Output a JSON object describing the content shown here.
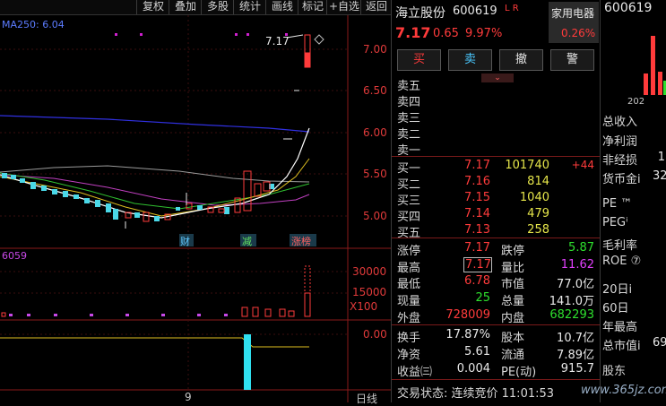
{
  "toolbar": {
    "items": [
      "复权",
      "叠加",
      "多股",
      "统计",
      "画线",
      "标记",
      "+自选",
      "返回"
    ]
  },
  "chart": {
    "ma_label": "MA250: 6.04",
    "price_ticks": [
      "7.00",
      "6.50",
      "6.00",
      "5.50",
      "5.00"
    ],
    "high_label": "7.17",
    "markers": [
      "财",
      "减",
      "涨榜"
    ],
    "vol_label": "6059",
    "vol_ticks": [
      "30000",
      "15000"
    ],
    "vol_unit": "X100",
    "macd_tick": "0.00",
    "date_label": "9",
    "period_label": "日线"
  },
  "quote": {
    "name": "海立股份",
    "code": "600619",
    "flags": "L R",
    "price": "7.17",
    "change": "0.65",
    "change_pct": "9.97%",
    "sector": "家用电器",
    "sector_pct": "0.26%",
    "buttons": {
      "buy": "买",
      "sell": "卖",
      "cancel": "撤",
      "alert": "警"
    },
    "asks": [
      {
        "label": "卖五",
        "price": "",
        "vol": ""
      },
      {
        "label": "卖四",
        "price": "",
        "vol": ""
      },
      {
        "label": "卖三",
        "price": "",
        "vol": ""
      },
      {
        "label": "卖二",
        "price": "",
        "vol": ""
      },
      {
        "label": "卖一",
        "price": "",
        "vol": ""
      }
    ],
    "bids": [
      {
        "label": "买一",
        "price": "7.17",
        "vol": "101740",
        "delta": "+44"
      },
      {
        "label": "买二",
        "price": "7.16",
        "vol": "814"
      },
      {
        "label": "买三",
        "price": "7.15",
        "vol": "1040"
      },
      {
        "label": "买四",
        "price": "7.14",
        "vol": "479"
      },
      {
        "label": "买五",
        "price": "7.13",
        "vol": "258"
      }
    ],
    "stats": {
      "limit_up_l": "涨停",
      "limit_up": "7.17",
      "limit_down_l": "跌停",
      "limit_down": "5.87",
      "high_l": "最高",
      "high": "7.17",
      "ratio_l": "量比",
      "ratio": "11.62",
      "low_l": "最低",
      "low": "6.78",
      "mcap_l": "市值",
      "mcap": "77.0亿",
      "now_l": "现量",
      "now": "25",
      "total_l": "总量",
      "total": "141.0万",
      "outer_l": "外盘",
      "outer": "728009",
      "inner_l": "内盘",
      "inner": "682293",
      "turn_l": "换手",
      "turn": "17.87%",
      "cap_l": "股本",
      "cap": "10.7亿",
      "nav_l": "净资",
      "nav": "5.61",
      "float_l": "流通",
      "float": "7.89亿",
      "eps_l": "收益㈢",
      "eps": "0.004",
      "pe_l": "PE(动)",
      "pe": "915.7"
    },
    "status": "交易状态: 连续竞价 11:01:53"
  },
  "side": {
    "code": "600619",
    "year": "202",
    "labels": [
      "总收入",
      "净利润",
      "非经损",
      "货币金i",
      "PE ™",
      "PEGⁱ",
      "毛利率",
      "ROE ⑦",
      "20日i",
      "60日",
      "年最高",
      "总市值i",
      "股东"
    ],
    "vals": {
      "nonrec": "1",
      "cash": "32",
      "mcap": "69"
    }
  },
  "watermark": "www.365jz.com"
}
